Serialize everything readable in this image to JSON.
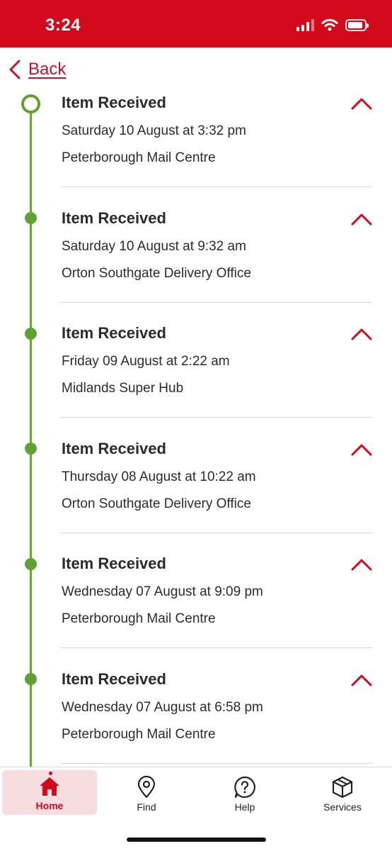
{
  "status_bar": {
    "time": "3:24"
  },
  "back": {
    "label": "Back"
  },
  "events": [
    {
      "title": "Item Received",
      "date": "Saturday 10 August at 3:32 pm",
      "location": "Peterborough Mail Centre"
    },
    {
      "title": "Item Received",
      "date": "Saturday 10 August at 9:32 am",
      "location": "Orton Southgate Delivery Office"
    },
    {
      "title": "Item Received",
      "date": "Friday 09 August at 2:22 am",
      "location": "Midlands Super Hub"
    },
    {
      "title": "Item Received",
      "date": "Thursday 08 August at 10:22 am",
      "location": "Orton Southgate Delivery Office"
    },
    {
      "title": "Item Received",
      "date": "Wednesday 07 August at 9:09 pm",
      "location": "Peterborough Mail Centre"
    },
    {
      "title": "Item Received",
      "date": "Wednesday 07 August at 6:58 pm",
      "location": "Peterborough Mail Centre"
    }
  ],
  "nav": {
    "home": "Home",
    "find": "Find",
    "help": "Help",
    "services": "Services"
  },
  "colors": {
    "brand_red": "#d20a1c",
    "timeline_green": "#5fa132",
    "active_tab_bg": "#f8dde0"
  },
  "icons": [
    "back-chevron-icon",
    "collapse-chevron-icon",
    "home-icon",
    "location-pin-icon",
    "help-icon",
    "parcel-box-icon",
    "signal-icon",
    "wifi-icon",
    "battery-icon"
  ]
}
